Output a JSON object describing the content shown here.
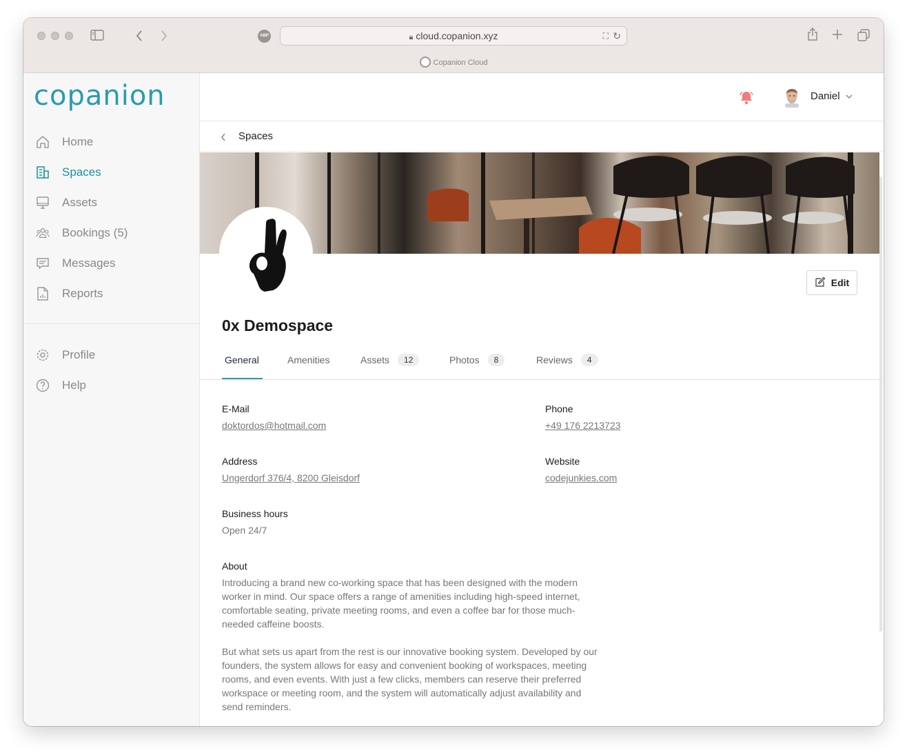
{
  "browser": {
    "url": "cloud.copanion.xyz",
    "tab_title": "Copanion Cloud",
    "adblock_label": "ABP"
  },
  "sidebar": {
    "logo": "copanion",
    "items": [
      {
        "label": "Home",
        "icon": "home-icon"
      },
      {
        "label": "Spaces",
        "icon": "building-icon",
        "active": true
      },
      {
        "label": "Assets",
        "icon": "monitor-icon"
      },
      {
        "label": "Bookings (5)",
        "icon": "users-icon"
      },
      {
        "label": "Messages",
        "icon": "chat-icon"
      },
      {
        "label": "Reports",
        "icon": "report-icon"
      }
    ],
    "secondary": [
      {
        "label": "Profile",
        "icon": "gear-icon"
      },
      {
        "label": "Help",
        "icon": "help-icon"
      }
    ],
    "accent_color": "#2a9bb0"
  },
  "header": {
    "user_name": "Daniel",
    "bell_color": "#f07c7c"
  },
  "breadcrumb": {
    "label": "Spaces"
  },
  "space": {
    "title": "0x Demospace",
    "edit_label": "Edit",
    "tabs": [
      {
        "label": "General",
        "active": true
      },
      {
        "label": "Amenities"
      },
      {
        "label": "Assets",
        "count": "12"
      },
      {
        "label": "Photos",
        "count": "8"
      },
      {
        "label": "Reviews",
        "count": "4"
      }
    ],
    "fields": {
      "email_label": "E-Mail",
      "email": "doktordos@hotmail.com",
      "phone_label": "Phone",
      "phone": "+49 176 2213723",
      "address_label": "Address",
      "address": "Ungerdorf 376/4, 8200 Gleisdorf",
      "website_label": "Website",
      "website": "codejunkies.com",
      "hours_label": "Business hours",
      "hours": "Open 24/7",
      "about_label": "About",
      "about_p1": "Introducing a brand new co-working space that has been designed with the modern worker in mind. Our space offers a range of amenities including high-speed internet, comfortable seating, private meeting rooms, and even a coffee bar for those much-needed caffeine boosts.",
      "about_p2": "But what sets us apart from the rest is our innovative booking system. Developed by our founders, the system allows for easy and convenient booking of workspaces, meeting rooms, and even events. With just a few clicks, members can reserve their preferred workspace or meeting room, and the system will automatically adjust availability and send reminders."
    }
  }
}
